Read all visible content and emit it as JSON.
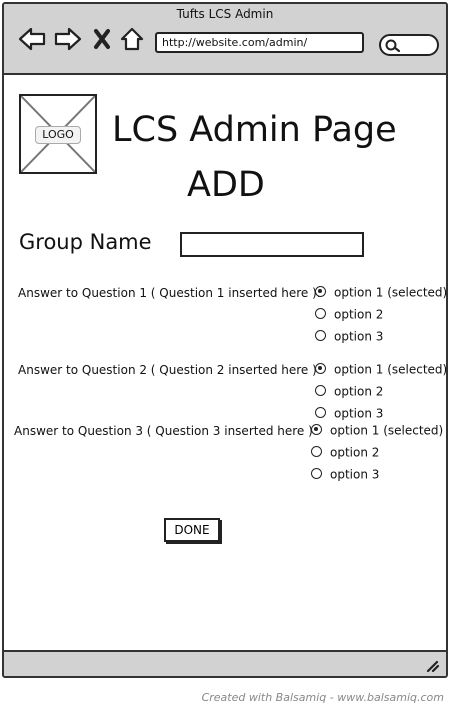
{
  "window": {
    "title": "Tufts LCS Admin",
    "url": "http://website.com/admin/"
  },
  "logo": {
    "label": "LOGO"
  },
  "header": {
    "title": "LCS Admin Page",
    "subtitle": "ADD"
  },
  "form": {
    "group_name_label": "Group Name",
    "group_name_value": "",
    "questions": [
      {
        "label": "Answer to Question 1 ( Question 1 inserted here ):",
        "options": [
          "option 1 (selected)",
          "option 2",
          "option 3"
        ],
        "selected_index": 0
      },
      {
        "label": "Answer to Question 2  ( Question 2 inserted here )",
        "options": [
          "option 1 (selected)",
          "option 2",
          "option 3"
        ],
        "selected_index": 0
      },
      {
        "label": "Answer to Question 3  ( Question 3 inserted here )",
        "options": [
          "option 1 (selected)",
          "option 2",
          "option 3"
        ],
        "selected_index": 0
      }
    ],
    "done_label": "DONE"
  },
  "footer": {
    "text": "Created with Balsamiq - www.balsamiq.com"
  },
  "colors": {
    "chrome": "#d2d2d2",
    "border": "#333333",
    "footer_text": "#888888"
  },
  "icons": [
    "back-arrow-icon",
    "forward-arrow-icon",
    "close-icon",
    "home-icon",
    "search-icon",
    "resize-grip-icon"
  ]
}
